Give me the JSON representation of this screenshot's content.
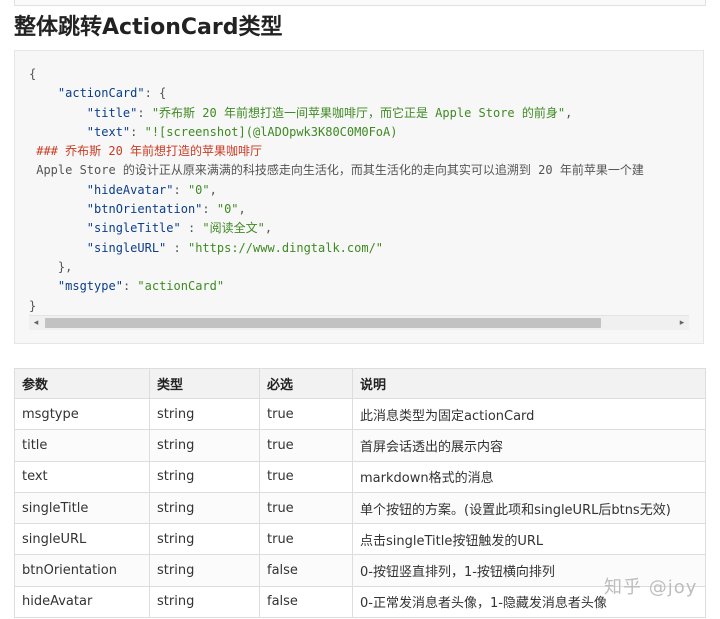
{
  "page": {
    "title": "整体跳转ActionCard类型"
  },
  "code": {
    "lines": [
      [
        {
          "t": "p",
          "v": "{"
        }
      ],
      [
        {
          "t": "p",
          "v": "    "
        },
        {
          "t": "k",
          "v": "\"actionCard\""
        },
        {
          "t": "p",
          "v": ": {"
        }
      ],
      [
        {
          "t": "p",
          "v": "        "
        },
        {
          "t": "k",
          "v": "\"title\""
        },
        {
          "t": "p",
          "v": ": "
        },
        {
          "t": "s",
          "v": "\"乔布斯 20 年前想打造一间苹果咖啡厅，而它正是 Apple Store 的前身\""
        },
        {
          "t": "p",
          "v": ","
        }
      ],
      [
        {
          "t": "p",
          "v": "        "
        },
        {
          "t": "k",
          "v": "\"text\""
        },
        {
          "t": "p",
          "v": ": "
        },
        {
          "t": "s",
          "v": "\"![screenshot](@lADOpwk3K80C0M0FoA)"
        }
      ],
      [
        {
          "t": "h",
          "v": " ### 乔布斯 20 年前想打造的苹果咖啡厅"
        }
      ],
      [
        {
          "t": "p",
          "v": " Apple Store 的设计正从原来满满的科技感走向生活化，而其生活化的走向其实可以追溯到 20 年前苹果一个建"
        }
      ],
      [
        {
          "t": "p",
          "v": "        "
        },
        {
          "t": "k",
          "v": "\"hideAvatar\""
        },
        {
          "t": "p",
          "v": ": "
        },
        {
          "t": "s",
          "v": "\"0\""
        },
        {
          "t": "p",
          "v": ","
        }
      ],
      [
        {
          "t": "p",
          "v": "        "
        },
        {
          "t": "k",
          "v": "\"btnOrientation\""
        },
        {
          "t": "p",
          "v": ": "
        },
        {
          "t": "s",
          "v": "\"0\""
        },
        {
          "t": "p",
          "v": ","
        }
      ],
      [
        {
          "t": "p",
          "v": "        "
        },
        {
          "t": "k",
          "v": "\"singleTitle\""
        },
        {
          "t": "p",
          "v": " : "
        },
        {
          "t": "s",
          "v": "\"阅读全文\""
        },
        {
          "t": "p",
          "v": ","
        }
      ],
      [
        {
          "t": "p",
          "v": "        "
        },
        {
          "t": "k",
          "v": "\"singleURL\""
        },
        {
          "t": "p",
          "v": " : "
        },
        {
          "t": "s",
          "v": "\"https://www.dingtalk.com/\""
        }
      ],
      [
        {
          "t": "p",
          "v": "    },"
        }
      ],
      [
        {
          "t": "p",
          "v": "    "
        },
        {
          "t": "k",
          "v": "\"msgtype\""
        },
        {
          "t": "p",
          "v": ": "
        },
        {
          "t": "s",
          "v": "\"actionCard\""
        }
      ],
      [
        {
          "t": "p",
          "v": "}"
        }
      ]
    ],
    "scroll_left_icon": "triangle-left-icon",
    "scroll_right_icon": "triangle-right-icon",
    "scroll_left_glyph": "◂",
    "scroll_right_glyph": "▸"
  },
  "table": {
    "headers": [
      "参数",
      "类型",
      "必选",
      "说明"
    ],
    "rows": [
      [
        "msgtype",
        "string",
        "true",
        "此消息类型为固定actionCard"
      ],
      [
        "title",
        "string",
        "true",
        "首屏会话透出的展示内容"
      ],
      [
        "text",
        "string",
        "true",
        "markdown格式的消息"
      ],
      [
        "singleTitle",
        "string",
        "true",
        "单个按钮的方案。(设置此项和singleURL后btns无效)"
      ],
      [
        "singleURL",
        "string",
        "true",
        "点击singleTitle按钮触发的URL"
      ],
      [
        "btnOrientation",
        "string",
        "false",
        "0-按钮竖直排列，1-按钮横向排列"
      ],
      [
        "hideAvatar",
        "string",
        "false",
        "0-正常发消息者头像，1-隐藏发消息者头像"
      ]
    ]
  },
  "watermark": {
    "text": "知乎 @joy"
  },
  "colors": {
    "key": "#0b3e8a",
    "string": "#3f8a23",
    "heading": "#c83c24"
  }
}
